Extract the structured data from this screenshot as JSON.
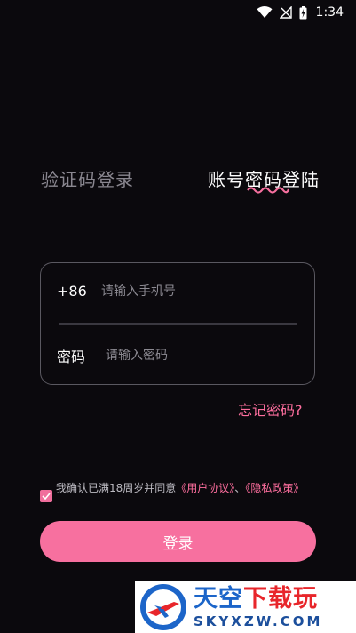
{
  "status_bar": {
    "time": "1:34"
  },
  "tabs": {
    "sms_login": "验证码登录",
    "account_login": "账号密码登陆"
  },
  "form": {
    "country_code": "+86",
    "phone_placeholder": "请输入手机号",
    "password_label": "密码",
    "password_placeholder": "请输入密码"
  },
  "forgot_password": "忘记密码?",
  "agreement": {
    "checked": true,
    "text": "我确认已满18周岁并同意",
    "user_agreement": "《用户协议》",
    "separator": "、",
    "privacy_policy": "《隐私政策》"
  },
  "login_button": "登录",
  "watermark": {
    "cn_blue": "天空",
    "cn_red": "下载玩",
    "en": "SKYXZW.COM"
  },
  "colors": {
    "accent": "#f7709f",
    "link": "#ff6f9f",
    "background": "#0b090d"
  }
}
